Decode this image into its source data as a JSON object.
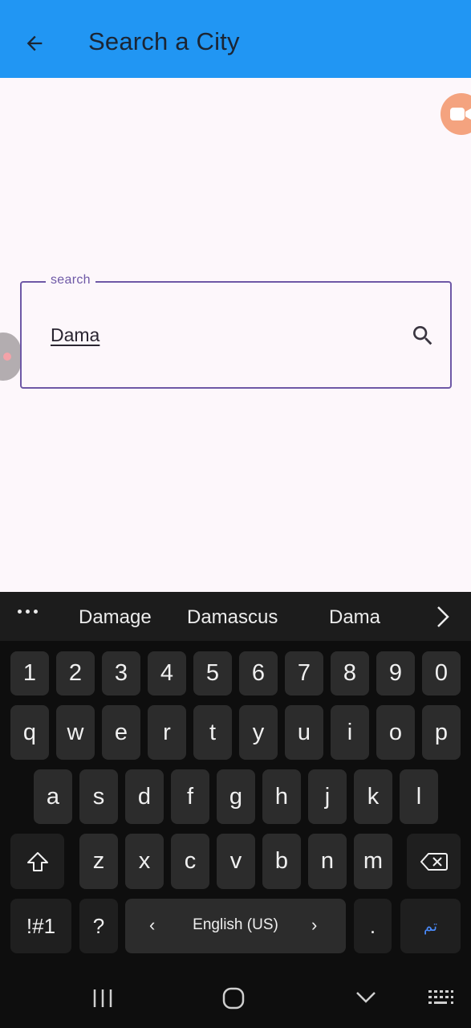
{
  "app": {
    "title": "Search a City",
    "back_icon": "arrow-left-icon",
    "accent_color": "#2196f3"
  },
  "search": {
    "label": "search",
    "value": "Dama",
    "icon": "search-icon",
    "border_color": "#6e58a6"
  },
  "keyboard": {
    "suggestions": [
      "Damage",
      "Damascus",
      "Dama"
    ],
    "number_row": [
      "1",
      "2",
      "3",
      "4",
      "5",
      "6",
      "7",
      "8",
      "9",
      "0"
    ],
    "row1": [
      "q",
      "w",
      "e",
      "r",
      "t",
      "y",
      "u",
      "i",
      "o",
      "p"
    ],
    "row2": [
      "a",
      "s",
      "d",
      "f",
      "g",
      "h",
      "j",
      "k",
      "l"
    ],
    "row3": [
      "z",
      "x",
      "c",
      "v",
      "b",
      "n",
      "m"
    ],
    "symbols_label": "!#1",
    "question_label": "?",
    "space_label": "English (US)",
    "period_label": ".",
    "done_label": "تم",
    "done_color": "#4a8cff"
  },
  "navbar": {
    "recents_icon": "recents-icon",
    "home_icon": "home-icon",
    "hide_keyboard_icon": "chevron-down-icon",
    "keyboard_icon": "keyboard-icon"
  }
}
